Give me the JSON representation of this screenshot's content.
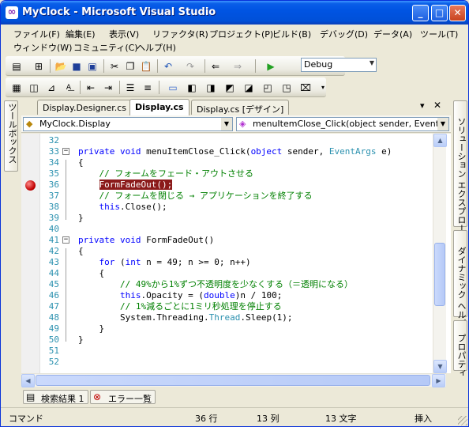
{
  "window": {
    "title": "MyClock - Microsoft Visual Studio"
  },
  "menu": [
    "ファイル(F)",
    "編集(E)",
    "表示(V)",
    "リファクタ(R)",
    "プロジェクト(P)",
    "ビルド(B)",
    "デバッグ(D)",
    "データ(A)",
    "ツール(T)",
    "ウィンドウ(W)",
    "コミュニティ(C)",
    "ヘルプ(H)"
  ],
  "toolbar": {
    "configuration": "Debug"
  },
  "side_left": {
    "toolbox_label": "ツールボックス"
  },
  "side_right": {
    "solution_explorer_label": "ソリューション エクスプローラ",
    "dynamic_help_label": "ダイナミック ヘルプ",
    "properties_label": "プロパティ"
  },
  "tabs": [
    {
      "label": "Display.Designer.cs",
      "active": false
    },
    {
      "label": "Display.cs",
      "active": true
    },
    {
      "label": "Display.cs [デザイン]",
      "active": false
    }
  ],
  "tab_controls": {
    "menu_glyph": "▾",
    "close_glyph": "✕"
  },
  "navigation": {
    "type_selector": "MyClock.Display",
    "member_selector": "menuItemClose_Click(object sender, EventAr"
  },
  "editor": {
    "breakpoint_line": 36,
    "lines": [
      {
        "num": "32",
        "text": ""
      },
      {
        "num": "33",
        "text": "private void menuItemClose_Click(object sender, EventArgs e)"
      },
      {
        "num": "34",
        "text": "{"
      },
      {
        "num": "35",
        "text": "    // フォームをフェード・アウトさせる"
      },
      {
        "num": "36",
        "text": "    FormFadeOut();"
      },
      {
        "num": "37",
        "text": "    // フォームを閉じる → アプリケーションを終了する"
      },
      {
        "num": "38",
        "text": "    this.Close();"
      },
      {
        "num": "39",
        "text": "}"
      },
      {
        "num": "40",
        "text": ""
      },
      {
        "num": "41",
        "text": "private void FormFadeOut()"
      },
      {
        "num": "42",
        "text": "{"
      },
      {
        "num": "43",
        "text": "    for (int n = 49; n >= 0; n++)"
      },
      {
        "num": "44",
        "text": "    {"
      },
      {
        "num": "45",
        "text": "        // 49%から1%ずつ不透明度を少なくする（＝透明になる）"
      },
      {
        "num": "46",
        "text": "        this.Opacity = (double)n / 100;"
      },
      {
        "num": "47",
        "text": "        // 1%減るごとに1ミリ秒処理を停止する"
      },
      {
        "num": "48",
        "text": "        System.Threading.Thread.Sleep(1);"
      },
      {
        "num": "49",
        "text": "    }"
      },
      {
        "num": "50",
        "text": "}"
      },
      {
        "num": "51",
        "text": ""
      },
      {
        "num": "52",
        "text": ""
      }
    ]
  },
  "bottom_tabs": [
    "検索結果 1",
    "エラー一覧"
  ],
  "status": {
    "mode": "コマンド",
    "line": "36 行",
    "column": "13 列",
    "char": "13 文字",
    "insert": "挿入"
  }
}
